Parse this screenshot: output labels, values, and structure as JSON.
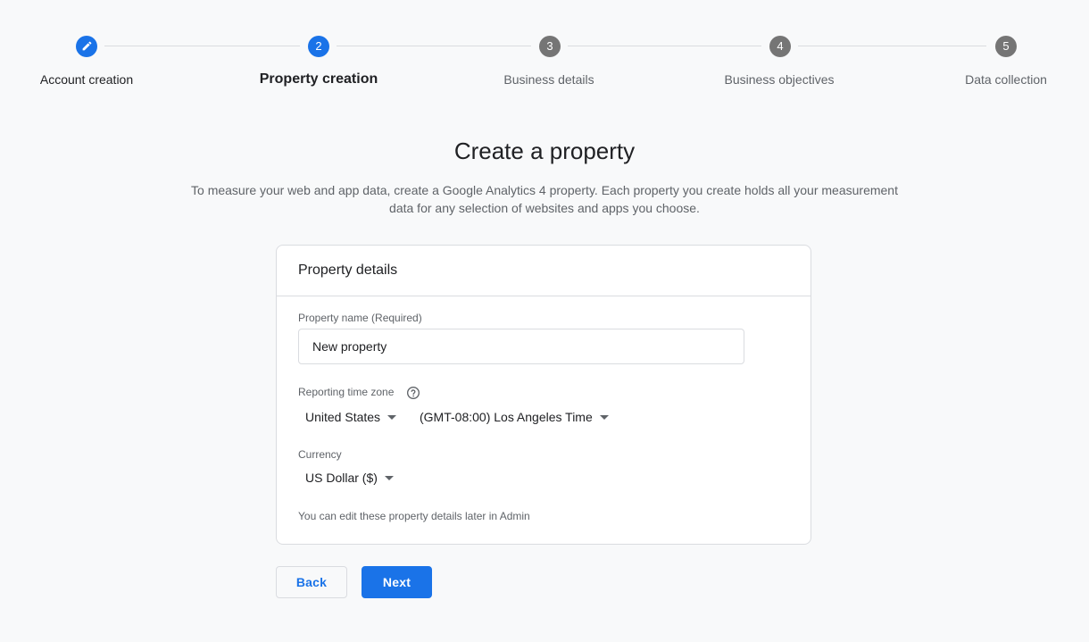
{
  "colors": {
    "accent": "#1a73e8",
    "inactive_step": "#757575",
    "background": "#f8f9fa",
    "border": "#dadce0"
  },
  "stepper": {
    "steps": [
      {
        "number": "",
        "label": "Account creation",
        "state": "done",
        "icon": "edit-pencil-icon"
      },
      {
        "number": "2",
        "label": "Property creation",
        "state": "active"
      },
      {
        "number": "3",
        "label": "Business details",
        "state": "upcoming"
      },
      {
        "number": "4",
        "label": "Business objectives",
        "state": "upcoming"
      },
      {
        "number": "5",
        "label": "Data collection",
        "state": "upcoming"
      }
    ]
  },
  "header": {
    "title": "Create a property",
    "subtitle": "To measure your web and app data, create a Google Analytics 4 property. Each property you create holds all your measurement data for any selection of websites and apps you choose."
  },
  "card": {
    "title": "Property details",
    "property_name_label": "Property name (Required)",
    "property_name_value": "New property",
    "timezone_label": "Reporting time zone",
    "help_icon": "help-circle-icon",
    "country_value": "United States",
    "timezone_value": "(GMT-08:00) Los Angeles Time",
    "currency_label": "Currency",
    "currency_value": "US Dollar ($)",
    "hint": "You can edit these property details later in Admin"
  },
  "actions": {
    "back_label": "Back",
    "next_label": "Next"
  }
}
